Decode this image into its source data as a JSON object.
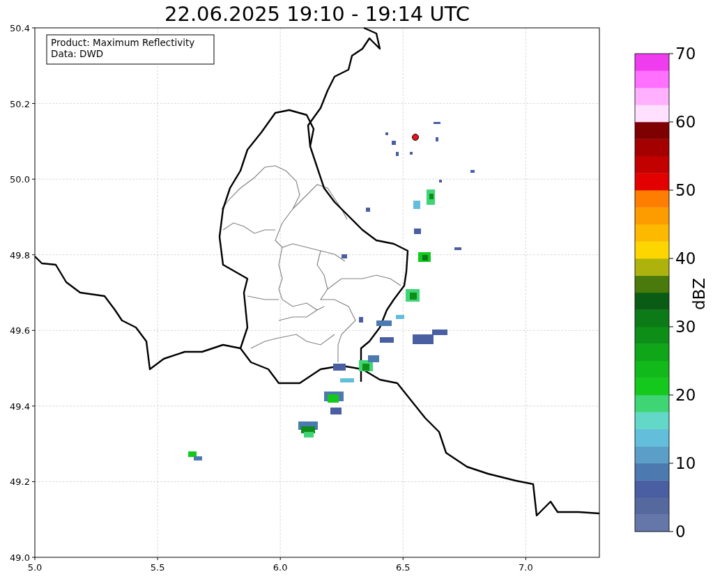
{
  "title": "22.06.2025 19:10 - 19:14 UTC",
  "info_box": {
    "lines": [
      "Product: Maximum Reflectivity",
      "Data: DWD"
    ]
  },
  "map": {
    "xticks": [
      "5.0",
      "5.5",
      "6.0",
      "6.5",
      "7.0"
    ],
    "yticks": [
      "50.4",
      "50.2",
      "50.0",
      "49.8",
      "49.6",
      "49.4",
      "49.2",
      "49.0"
    ]
  },
  "colorbar": {
    "label": "dBZ",
    "ticks": [
      "70",
      "60",
      "50",
      "40",
      "30",
      "20",
      "10",
      "0"
    ],
    "bands": [
      {
        "color": "#6577a8"
      },
      {
        "color": "#56699f"
      },
      {
        "color": "#4a5fa2"
      },
      {
        "color": "#4c79b0"
      },
      {
        "color": "#5b9ec8"
      },
      {
        "color": "#62bedb"
      },
      {
        "color": "#63d8c8"
      },
      {
        "color": "#3fd574"
      },
      {
        "color": "#14c91c"
      },
      {
        "color": "#12b91a"
      },
      {
        "color": "#10a61a"
      },
      {
        "color": "#0c8e17"
      },
      {
        "color": "#0d7a18"
      },
      {
        "color": "#0a5c14"
      },
      {
        "color": "#4a7a0c"
      },
      {
        "color": "#adb20c"
      },
      {
        "color": "#fdd600"
      },
      {
        "color": "#fdb800"
      },
      {
        "color": "#fd9c00"
      },
      {
        "color": "#fd7e00"
      },
      {
        "color": "#e30000"
      },
      {
        "color": "#c20000"
      },
      {
        "color": "#a50000"
      },
      {
        "color": "#7e0000"
      },
      {
        "color": "#ffe0ff"
      },
      {
        "color": "#ffb0ff"
      },
      {
        "color": "#ff70ff"
      },
      {
        "color": "#ef3cef"
      }
    ]
  }
}
